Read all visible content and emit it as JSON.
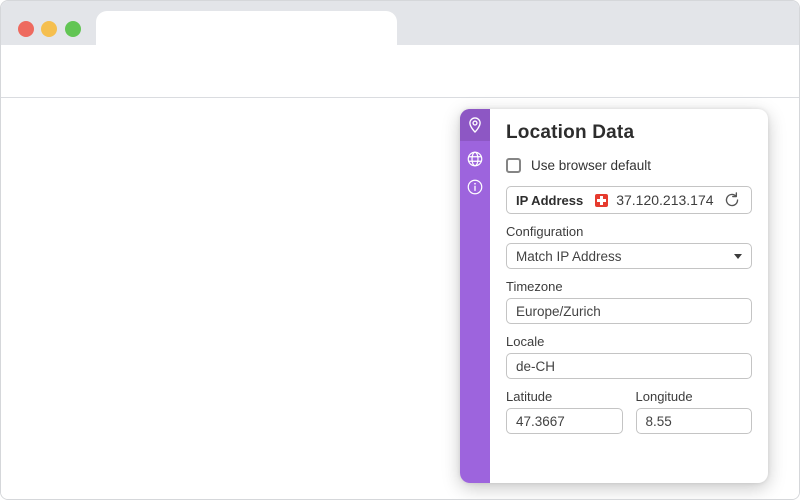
{
  "browser": {
    "tab": {
      "title": ""
    },
    "address_bar": {
      "value": "",
      "placeholder": ""
    },
    "icons": [
      "back-arrow",
      "forward-arrow",
      "reload",
      "extension-logo",
      "kebab-menu"
    ]
  },
  "popup": {
    "title": "Location Data",
    "use_browser_default": {
      "label": "Use browser default",
      "checked": false
    },
    "ip": {
      "label": "IP Address",
      "value": "37.120.213.174",
      "flag": "swiss-flag"
    },
    "fields": {
      "configuration": {
        "label": "Configuration",
        "value": "Match IP Address"
      },
      "timezone": {
        "label": "Timezone",
        "value": "Europe/Zurich"
      },
      "locale": {
        "label": "Locale",
        "value": "de-CH"
      },
      "latitude": {
        "label": "Latitude",
        "value": "47.3667"
      },
      "longitude": {
        "label": "Longitude",
        "value": "8.55"
      }
    },
    "sidebar": {
      "items": [
        {
          "icon": "location-pin",
          "active": true
        },
        {
          "icon": "globe",
          "active": false
        },
        {
          "icon": "info",
          "active": false
        }
      ]
    }
  },
  "colors": {
    "accent_purple": "#9d64dd",
    "sidebar_active_purple": "#8d57c4",
    "extension_icon_purple": "#9257d2",
    "flag_red": "#e63b2e",
    "traffic_red": "#ee6a5f",
    "traffic_yellow": "#f5bf4f",
    "traffic_green": "#62c554"
  }
}
